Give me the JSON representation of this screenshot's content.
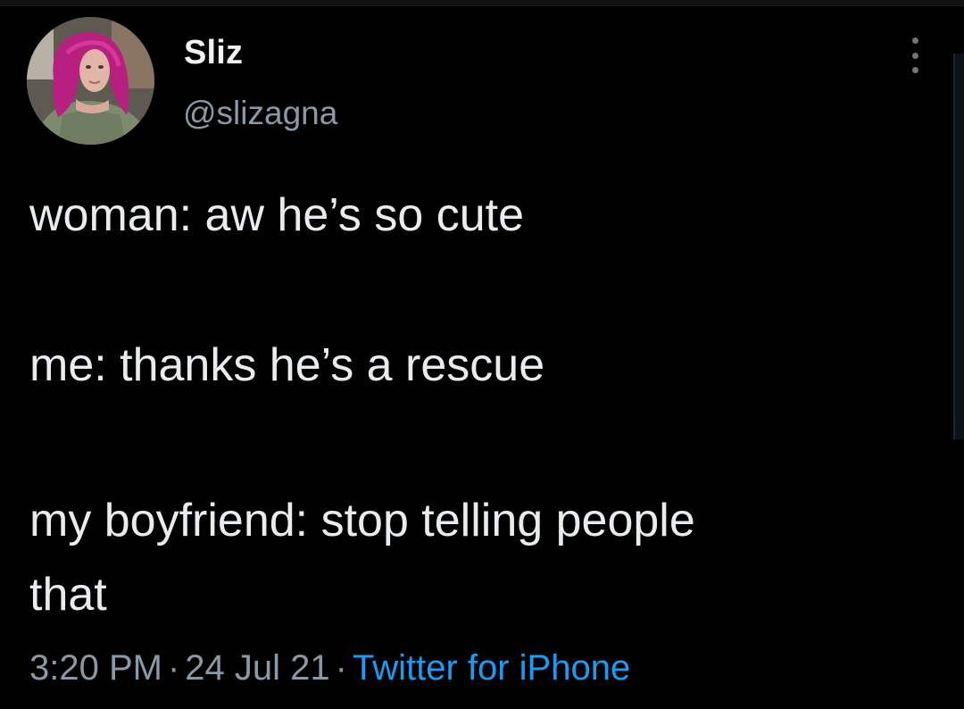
{
  "user": {
    "display_name": "Sliz",
    "handle": "@slizagna",
    "avatar_icon": "profile-photo"
  },
  "tweet": {
    "lines": [
      "woman: aw he’s so cute",
      "me: thanks he’s a rescue",
      "my boyfriend: stop telling people",
      "that"
    ],
    "time": "3:20 PM",
    "date": "24 Jul 21",
    "source": "Twitter for iPhone",
    "separator": "·"
  },
  "more_icon": "more-vertical-icon",
  "colors": {
    "background": "#000000",
    "text": "#e9ecee",
    "muted": "#8b98a5",
    "link": "#1d9bf0"
  }
}
